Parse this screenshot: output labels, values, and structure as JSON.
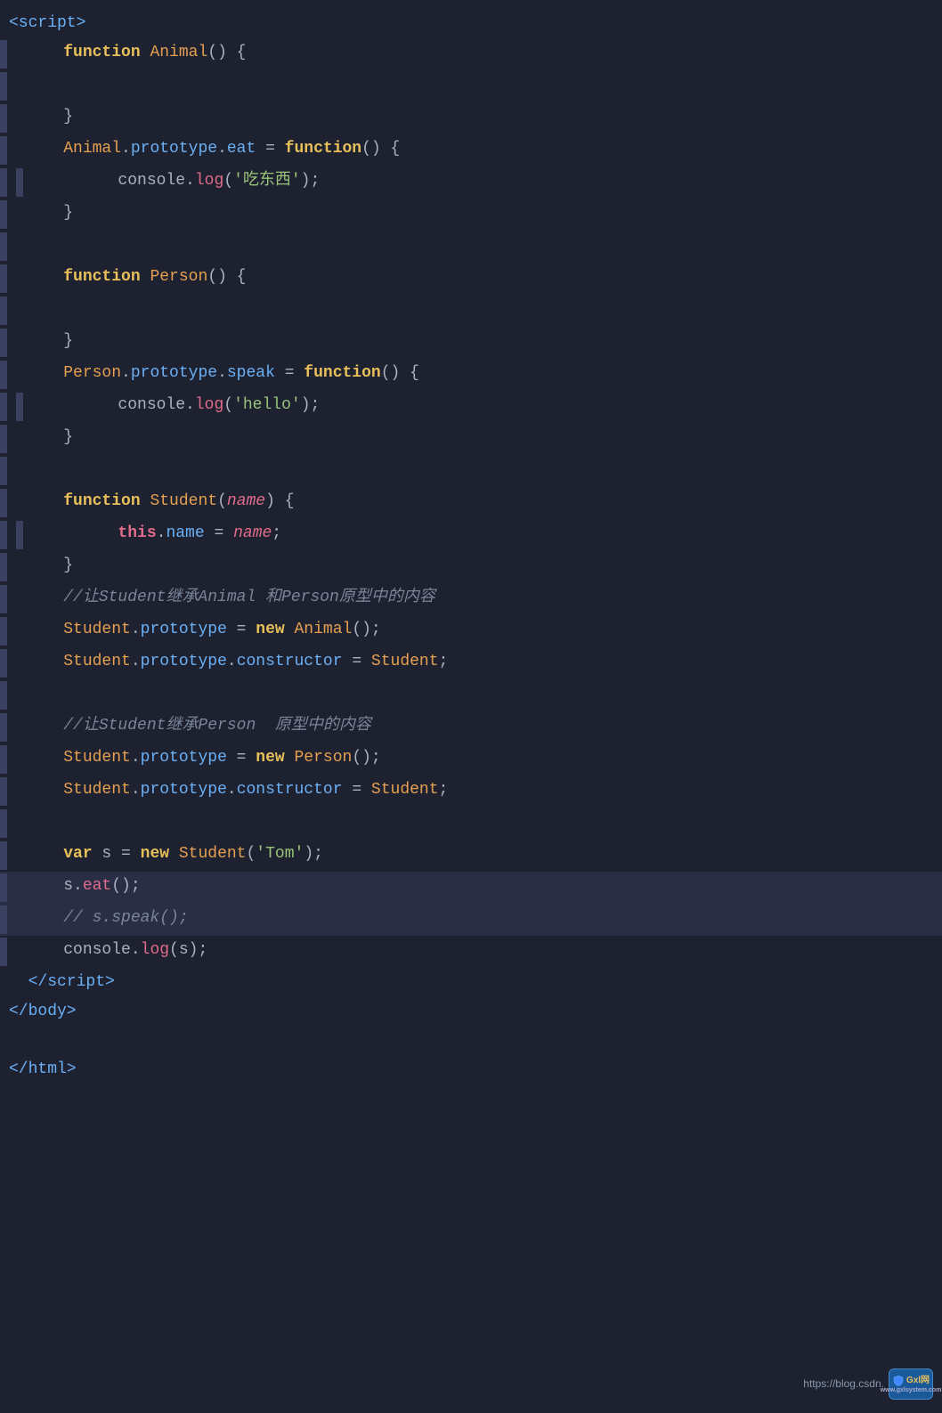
{
  "code": {
    "lines": [
      {
        "indent": 0,
        "highlighted": false,
        "bar": false
      },
      {
        "indent": 1,
        "highlighted": false,
        "bar": true
      },
      {
        "indent": 1,
        "highlighted": false,
        "bar": true
      },
      {
        "indent": 1,
        "highlighted": false,
        "bar": true
      },
      {
        "indent": 1,
        "highlighted": false,
        "bar": true
      },
      {
        "indent": 2,
        "highlighted": false,
        "bar": true
      },
      {
        "indent": 1,
        "highlighted": false,
        "bar": true
      },
      {
        "indent": 1,
        "highlighted": false,
        "bar": true
      },
      {
        "indent": 1,
        "highlighted": false,
        "bar": true
      },
      {
        "indent": 1,
        "highlighted": false,
        "bar": true
      },
      {
        "indent": 1,
        "highlighted": false,
        "bar": true
      },
      {
        "indent": 1,
        "highlighted": false,
        "bar": true
      },
      {
        "indent": 2,
        "highlighted": false,
        "bar": true
      },
      {
        "indent": 1,
        "highlighted": false,
        "bar": true
      },
      {
        "indent": 1,
        "highlighted": false,
        "bar": true
      },
      {
        "indent": 1,
        "highlighted": false,
        "bar": true
      }
    ],
    "watermark_url": "https://blog.csdn.",
    "watermark_brand": "Gxl网",
    "watermark_sub": "www.gxlsystem.com"
  }
}
